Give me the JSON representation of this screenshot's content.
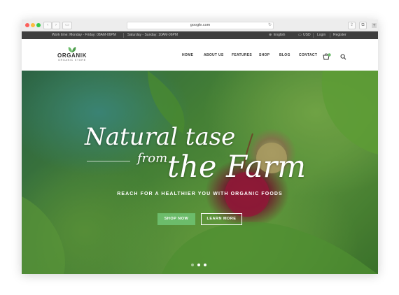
{
  "browser": {
    "url": "google.com",
    "back_icon": "chevron-left-icon",
    "forward_icon": "chevron-right-icon"
  },
  "topbar": {
    "weekday_hours": "Work time: Monday - Friday: 08AM-06PM",
    "weekend_hours": "Saturday - Sunday: 10AM-06PM",
    "language": "English",
    "currency": "USD",
    "login": "Login",
    "register": "Register"
  },
  "header": {
    "logo_name": "ORGANIK",
    "logo_tagline": "ORGANIC STORE",
    "nav": [
      "HOME",
      "ABOUT US",
      "FEATURES",
      "SHOP",
      "BLOG",
      "CONTACT"
    ],
    "cart_count": "0"
  },
  "hero": {
    "headline_line1": "Natural tase",
    "headline_from": "from",
    "headline_line2": "the Farm",
    "tagline": "REACH FOR A HEALTHIER YOU WITH ORGANIC FOODS",
    "shop_button": "SHOP NOW",
    "learn_button": "LEARN MORE",
    "slides": 3,
    "active_slide": 2
  },
  "colors": {
    "accent_green": "#6cbc6b",
    "topbar_bg": "#3e3e3e"
  }
}
